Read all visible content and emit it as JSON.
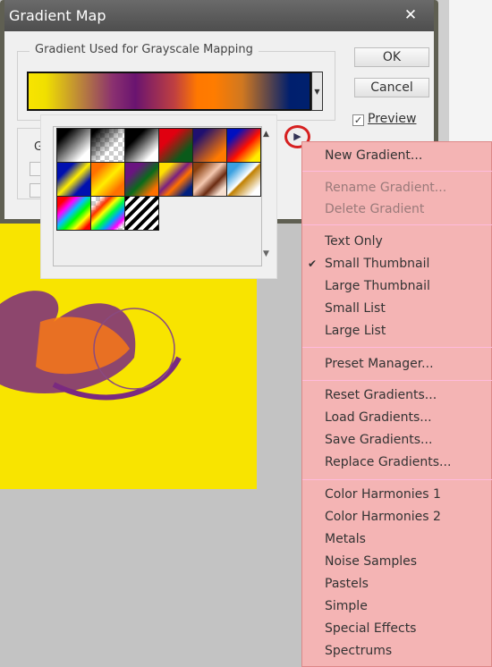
{
  "dialog": {
    "title": "Gradient Map",
    "close_label": "✕",
    "group_label": "Gradient Used for Grayscale Mapping",
    "ok": "OK",
    "cancel": "Cancel",
    "preview_label": "Preview",
    "preview_checked": true,
    "partial_label": "G"
  },
  "gradient": {
    "colors": [
      "#f8e400",
      "#6a1470",
      "#ff7800",
      "#00206e"
    ]
  },
  "popup": {
    "scroll_up": "▲",
    "scroll_down": "▼",
    "menu_button": "▶",
    "swatch_count": 15
  },
  "menu": {
    "items": [
      {
        "label": "New Gradient...",
        "enabled": true
      },
      {
        "label": "Rename Gradient...",
        "enabled": false
      },
      {
        "label": "Delete Gradient",
        "enabled": false
      },
      {
        "label": "Text Only",
        "enabled": true
      },
      {
        "label": "Small Thumbnail",
        "enabled": true,
        "checked": true
      },
      {
        "label": "Large Thumbnail",
        "enabled": true
      },
      {
        "label": "Small List",
        "enabled": true
      },
      {
        "label": "Large List",
        "enabled": true
      },
      {
        "label": "Preset Manager...",
        "enabled": true
      },
      {
        "label": "Reset Gradients...",
        "enabled": true
      },
      {
        "label": "Load Gradients...",
        "enabled": true
      },
      {
        "label": "Save Gradients...",
        "enabled": true
      },
      {
        "label": "Replace Gradients...",
        "enabled": true
      },
      {
        "label": "Color Harmonies 1",
        "enabled": true
      },
      {
        "label": "Color Harmonies 2",
        "enabled": true
      },
      {
        "label": "Metals",
        "enabled": true
      },
      {
        "label": "Noise Samples",
        "enabled": true
      },
      {
        "label": "Pastels",
        "enabled": true
      },
      {
        "label": "Simple",
        "enabled": true
      },
      {
        "label": "Special Effects",
        "enabled": true
      },
      {
        "label": "Spectrums",
        "enabled": true
      }
    ],
    "check_mark": "✔"
  },
  "colors": {
    "menu_bg": "#f4b4b4",
    "highlight_ring": "#d62020",
    "canvas": "#f8e400"
  }
}
